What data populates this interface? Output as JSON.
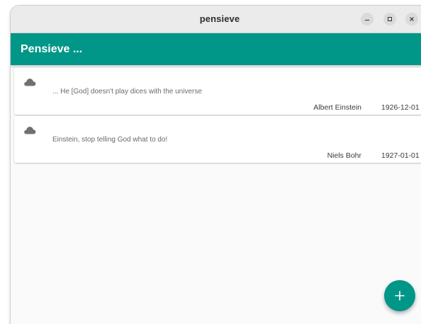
{
  "window": {
    "title": "pensieve",
    "controls": {
      "minimize": "minimize-icon",
      "maximize": "maximize-icon",
      "close": "close-icon"
    }
  },
  "appbar": {
    "title": "Pensieve ..."
  },
  "quotes": [
    {
      "icon": "cloud-icon",
      "text": "... He [God] doesn't play dices with the universe",
      "author": "Albert Einstein",
      "date": "1926-12-01"
    },
    {
      "icon": "cloud-icon",
      "text": "Einstein, stop telling God what to do!",
      "author": "Niels Bohr",
      "date": "1927-01-01"
    }
  ],
  "fab": {
    "icon": "plus-icon"
  },
  "colors": {
    "primary": "#009688",
    "titlebar": "#ebebeb",
    "background": "#fafafa",
    "icon_gray": "#707070"
  }
}
